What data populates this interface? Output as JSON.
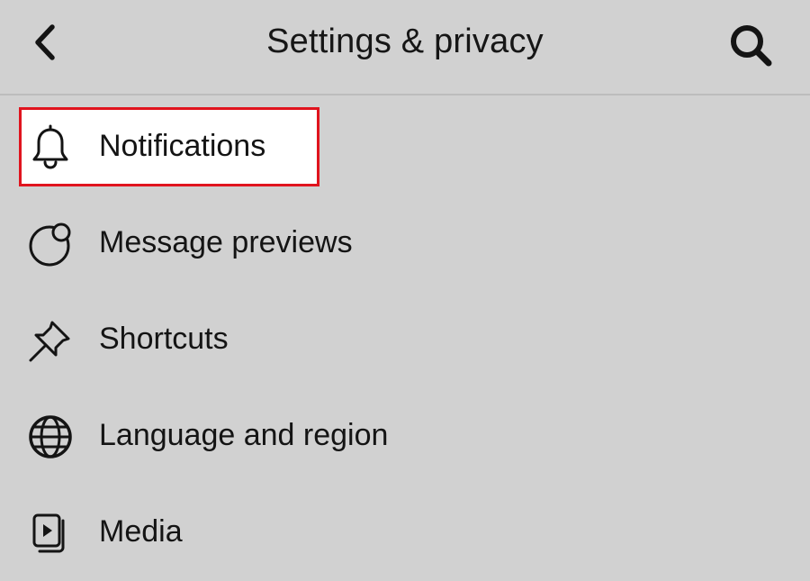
{
  "header": {
    "title": "Settings & privacy",
    "back_icon": "chevron-left-icon",
    "search_icon": "search-icon"
  },
  "menu": {
    "items": [
      {
        "label": "Notifications",
        "icon": "bell-icon",
        "highlighted": true
      },
      {
        "label": "Message previews",
        "icon": "message-preview-icon"
      },
      {
        "label": "Shortcuts",
        "icon": "pin-icon"
      },
      {
        "label": "Language and region",
        "icon": "globe-icon"
      },
      {
        "label": "Media",
        "icon": "media-icon"
      }
    ]
  },
  "colors": {
    "background": "#d1d1d1",
    "highlight_border": "#e0141e",
    "highlight_fill": "#ffffff",
    "text": "#141414"
  }
}
